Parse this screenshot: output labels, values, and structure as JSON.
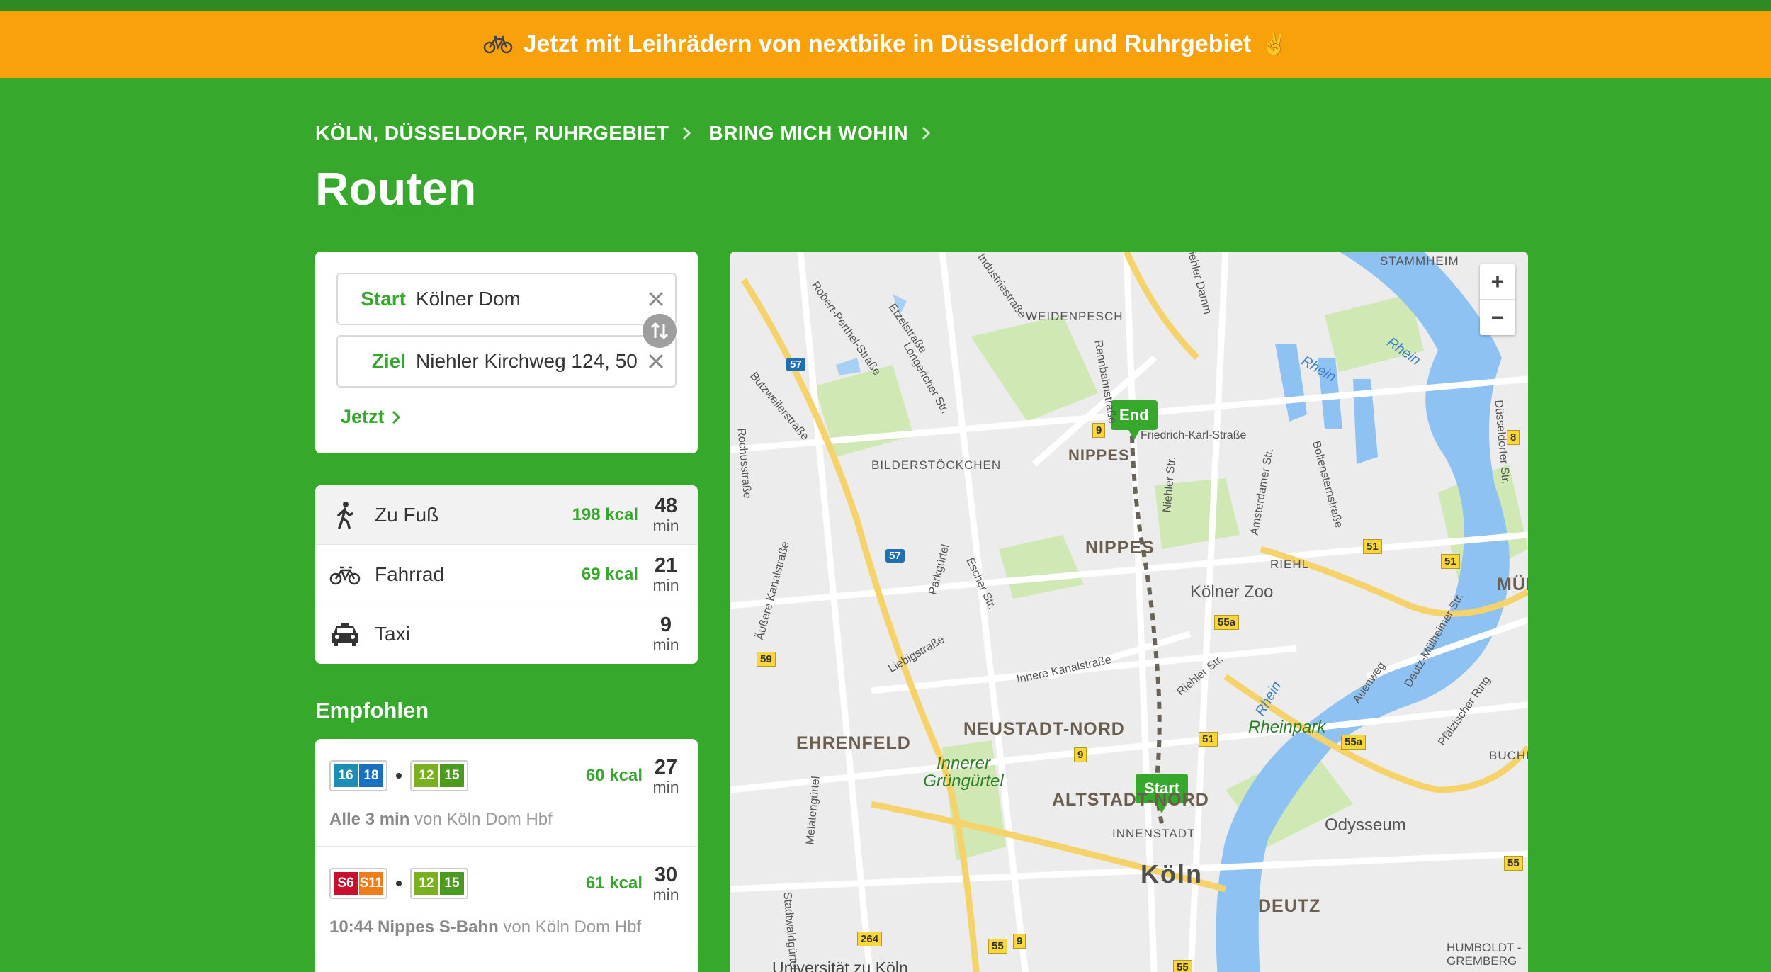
{
  "banner": {
    "text": "Jetzt mit Leihrädern von nextbike in Düsseldorf und Ruhrgebiet",
    "emoji": "✌"
  },
  "breadcrumb": {
    "items": [
      "KÖLN, DÜSSELDORF, RUHRGEBIET",
      "BRING MICH WOHIN"
    ]
  },
  "page": {
    "title": "Routen"
  },
  "search": {
    "start_label": "Start",
    "start_value": "Kölner Dom",
    "ziel_label": "Ziel",
    "ziel_value": "Niehler Kirchweg 124, 50",
    "time_label": "Jetzt"
  },
  "modes": [
    {
      "icon": "walk-icon",
      "name": "Zu Fuß",
      "kcal": "198 kcal",
      "time": "48",
      "unit": "min"
    },
    {
      "icon": "bicycle-icon",
      "name": "Fahrrad",
      "kcal": "69 kcal",
      "time": "21",
      "unit": "min"
    },
    {
      "icon": "taxi-icon",
      "name": "Taxi",
      "kcal": "",
      "time": "9",
      "unit": "min"
    }
  ],
  "recommended": {
    "heading": "Empfohlen",
    "routes": [
      {
        "lines_a": [
          "16",
          "18"
        ],
        "lines_b": [
          "12",
          "15"
        ],
        "kcal": "60 kcal",
        "time": "27",
        "unit": "min",
        "info_bold": "Alle 3 min",
        "info_rest": " von Köln Dom Hbf"
      },
      {
        "lines_a": [
          "S6",
          "S11"
        ],
        "lines_b": [
          "12",
          "15"
        ],
        "kcal": "61 kcal",
        "time": "30",
        "unit": "min",
        "info_bold": "10:44 Nippes S-Bahn",
        "info_rest": " von Köln Dom Hbf"
      }
    ]
  },
  "map": {
    "zoom_in": "+",
    "zoom_out": "−",
    "start_marker": "Start",
    "end_marker": "End",
    "labels": {
      "stammheim": "STAMMHEIM",
      "weidenpesch": "WEIDENPESCH",
      "bilderstoeckchen": "BILDERSTÖCKCHEN",
      "nippes_small": "NIPPES",
      "nippes": "NIPPES",
      "riehl": "RIEHL",
      "muelheim": "MÜLHE",
      "ehrenfeld": "EHRENFELD",
      "neustadt_nord": "NEUSTADT-NORD",
      "altstadt_nord": "ALTSTADT-NORD",
      "innenstadt": "INNENSTADT",
      "koeln": "Köln",
      "deutz": "DEUTZ",
      "buchforst": "BUCHFORS",
      "humboldt": "HUMBOLDT - GREMBERG",
      "zoo": "Kölner Zoo",
      "odysseum": "Odysseum",
      "rheinpark": "Rheinpark",
      "innerer_guertel": "Innerer Grüngürtel",
      "uni": "Universität zu Köln",
      "rhein1": "Rhein",
      "rhein2": "Rhein",
      "rhein3": "Rhein",
      "friedrich": "Friedrich-Karl-Straße",
      "niehler_str": "Niehler Str.",
      "amsterdamer": "Amsterdamer Str.",
      "boltenstern": "Boltensternstraße",
      "riehler": "Riehler Str.",
      "innere_kanal": "Innere Kanalstraße",
      "aeussere_kanal": "Äußere Kanalstraße",
      "liebig": "Liebigstraße",
      "parkguertel": "Parkgürtel",
      "escher": "Escher Str.",
      "etzel": "Etzelstraße",
      "longericher": "Longericher Str.",
      "robert_perthel": "Robert-Perthel-Straße",
      "butzweiler": "Butzweilerstraße",
      "rochus": "Rochusstraße",
      "melaten": "Melatengürtel",
      "stadtwald": "Stadtwaldgürtel",
      "auenweg": "Auenweg",
      "deutz_muelheimer": "Deutz-Mülheimer Str.",
      "pfaelzischer": "Pfälzischer Ring",
      "duesseldorfer": "Düsseldorfer Str.",
      "industrie": "Industriestraße",
      "niehler_damm": "Niehler Damm",
      "renn": "Rennbahnstraße"
    },
    "shields": [
      "57",
      "57",
      "9",
      "9",
      "9",
      "51",
      "51",
      "51",
      "55a",
      "55a",
      "59",
      "8",
      "55",
      "55",
      "55",
      "264"
    ]
  }
}
